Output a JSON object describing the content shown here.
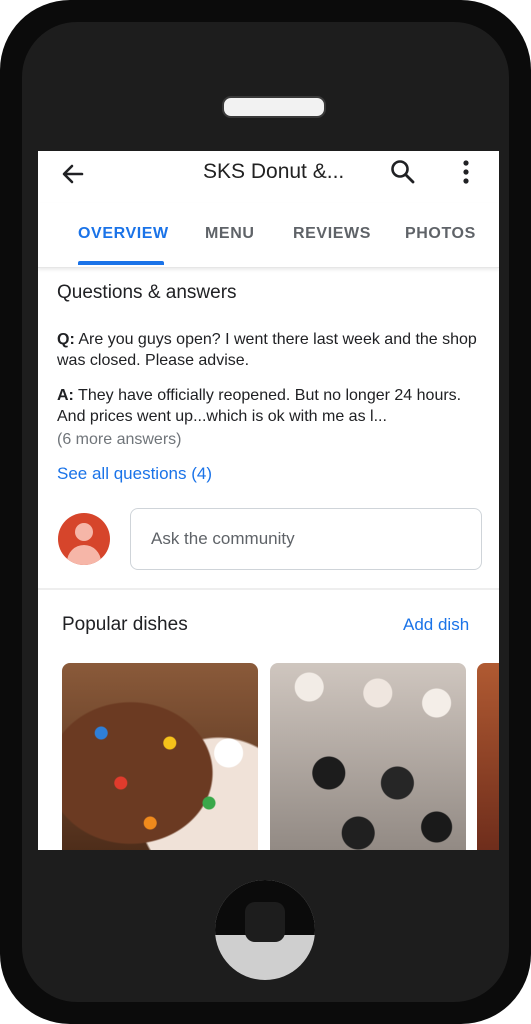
{
  "appbar": {
    "title": "SKS Donut &...",
    "back_icon": "arrow-back-icon",
    "search_icon": "search-icon",
    "more_icon": "more-vert-icon"
  },
  "tabs": [
    {
      "label": "OVERVIEW",
      "active": true
    },
    {
      "label": "MENU",
      "active": false
    },
    {
      "label": "REVIEWS",
      "active": false
    },
    {
      "label": "PHOTOS",
      "active": false
    }
  ],
  "qa": {
    "title": "Questions & answers",
    "q_label": "Q:",
    "question": "Are you guys open? I went there last week and the shop was closed. Please advise.",
    "a_label": "A:",
    "answer": "They have officially reopened. But no longer 24 hours. And prices went up...which is ok with me as l...",
    "more_answers": "(6 more answers)",
    "see_all": "See all questions (4)",
    "ask_placeholder": "Ask the community"
  },
  "dishes": {
    "title": "Popular dishes",
    "add_label": "Add dish"
  },
  "colors": {
    "accent": "#1a73e8",
    "avatar": "#d6452b"
  }
}
